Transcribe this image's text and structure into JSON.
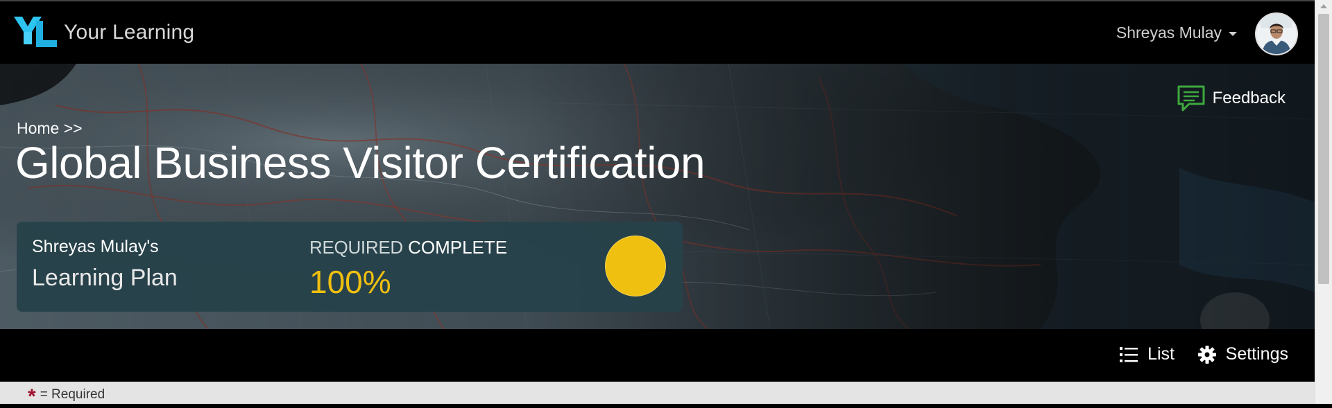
{
  "header": {
    "brand_name": "Your Learning",
    "logo_text": "YL",
    "user_name": "Shreyas Mulay"
  },
  "hero": {
    "feedback_label": "Feedback",
    "breadcrumb": "Home >>",
    "title": "Global Business Visitor Certification"
  },
  "plan_card": {
    "owner": "Shreyas Mulay's",
    "plan_name": "Learning Plan",
    "required_label": "REQUIRED",
    "complete_label": "COMPLETE",
    "percent": "100%",
    "progress_fraction": 1.0,
    "progress_color": "#f0c010"
  },
  "toolbar": {
    "list_label": "List",
    "settings_label": "Settings"
  },
  "legend": {
    "symbol": "*",
    "text": "= Required"
  },
  "colors": {
    "brand_accent": "#2ec4f0",
    "card_bg": "#26424a",
    "required_star": "#a01432",
    "feedback_icon": "#3ea83e"
  },
  "icons": {
    "logo": "yl-logo",
    "user_menu": "caret-down-icon",
    "avatar": "user-avatar",
    "feedback": "chat-bubble-icon",
    "list": "list-icon",
    "settings": "gear-icon"
  }
}
